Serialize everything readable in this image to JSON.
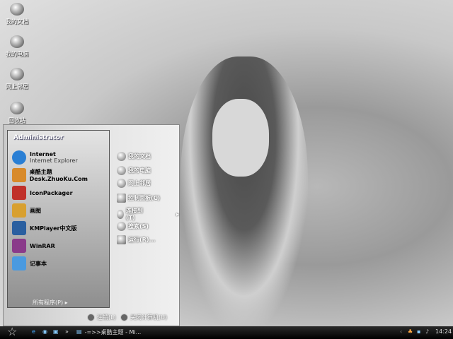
{
  "desktop": {
    "icons": [
      {
        "label": "我的文档",
        "icon": "my-documents-icon"
      },
      {
        "label": "我的电脑",
        "icon": "my-computer-icon"
      },
      {
        "label": "网上邻居",
        "icon": "network-icon"
      },
      {
        "label": "回收站",
        "icon": "recycle-bin-icon"
      }
    ]
  },
  "start_menu": {
    "user": "Administrator",
    "programs": [
      {
        "label": "Internet",
        "sub": "Internet Explorer",
        "color": "#2a7fd4"
      },
      {
        "label": "桌酷主题Desk.ZhuoKu.Com",
        "color": "#d88a2a"
      },
      {
        "label": "IconPackager",
        "color": "#c0302a"
      },
      {
        "label": "画图",
        "color": "#d8a030"
      },
      {
        "label": "KMPlayer中文版",
        "color": "#2a5fa0"
      },
      {
        "label": "WinRAR",
        "color": "#8a3a8a"
      },
      {
        "label": "记事本",
        "color": "#4a9ae0"
      }
    ],
    "all_programs": "所有程序(P)",
    "places": [
      "我的文档",
      "我的电脑",
      "网上邻居",
      "控制面板(C)",
      "连接到(T)",
      "搜索(S)",
      "运行(R)..."
    ],
    "logoff": "注销(L)",
    "shutdown": "关闭计算机(U)"
  },
  "taskbar": {
    "window": "-=>>桌酷主题 - Mi...",
    "clock": "14:24",
    "chevron": "»"
  }
}
